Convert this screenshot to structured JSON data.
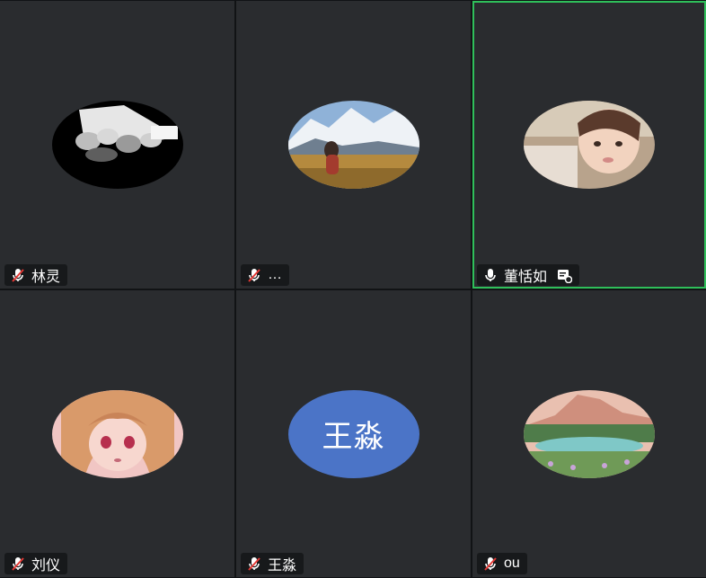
{
  "participants": [
    {
      "name": "林灵",
      "mic": "mic-muted-icon",
      "avatar": "photo-black-white-group"
    },
    {
      "name": "…",
      "mic": "mic-muted-icon",
      "avatar": "photo-mountain-person"
    },
    {
      "name": "董恬如",
      "mic": "mic-on-icon",
      "avatar": "photo-child",
      "active": true,
      "extra_icon": "screen-share-icon"
    },
    {
      "name": "刘仪",
      "mic": "mic-muted-icon",
      "avatar": "photo-anime-girl"
    },
    {
      "name": "王淼",
      "mic": "mic-muted-icon",
      "avatar_text": "王淼"
    },
    {
      "name": "ou",
      "mic": "mic-muted-icon",
      "avatar": "painting-lake-mountain"
    }
  ],
  "colors": {
    "active_border": "#2fbf5a",
    "text_avatar_bg": "#4b74c7",
    "tile_bg": "#2a2c2f"
  }
}
